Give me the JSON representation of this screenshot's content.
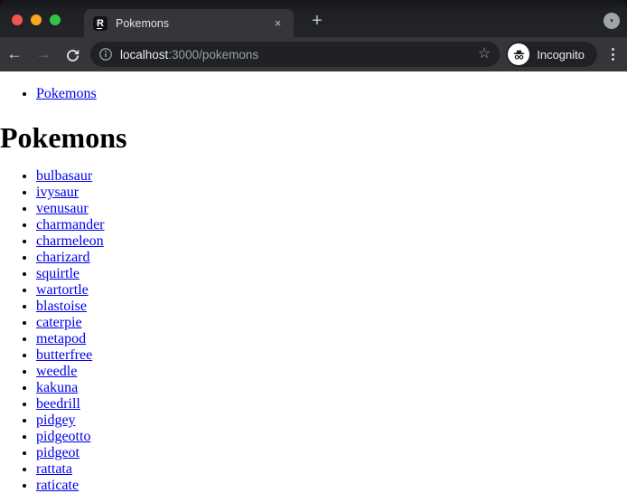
{
  "window": {
    "traffic_lights": {
      "close_color": "#f0564c",
      "minimize_color": "#f6a91f",
      "zoom_color": "#31c546"
    },
    "tab": {
      "title": "Pokemons",
      "favicon_glyph": "R",
      "close_icon": "×"
    },
    "new_tab_icon": "+",
    "tab_search_icon": "▾",
    "toolbar": {
      "back_icon": "←",
      "forward_icon": "→",
      "address": {
        "host": "localhost",
        "rest": ":3000/pokemons",
        "bookmark_icon": "☆"
      },
      "incognito_label": "Incognito"
    }
  },
  "page": {
    "nav_links": [
      "Pokemons"
    ],
    "heading": "Pokemons",
    "pokemons": [
      "bulbasaur",
      "ivysaur",
      "venusaur",
      "charmander",
      "charmeleon",
      "charizard",
      "squirtle",
      "wartortle",
      "blastoise",
      "caterpie",
      "metapod",
      "butterfree",
      "weedle",
      "kakuna",
      "beedrill",
      "pidgey",
      "pidgeotto",
      "pidgeot",
      "rattata",
      "raticate"
    ]
  },
  "colors": {
    "frame": "#202124",
    "toolbar": "#35363a",
    "field": "#202124",
    "text_primary": "#e8eaed",
    "text_secondary": "#9aa0a6",
    "page_background": "#ffffff",
    "page_link": "#0000ee"
  }
}
